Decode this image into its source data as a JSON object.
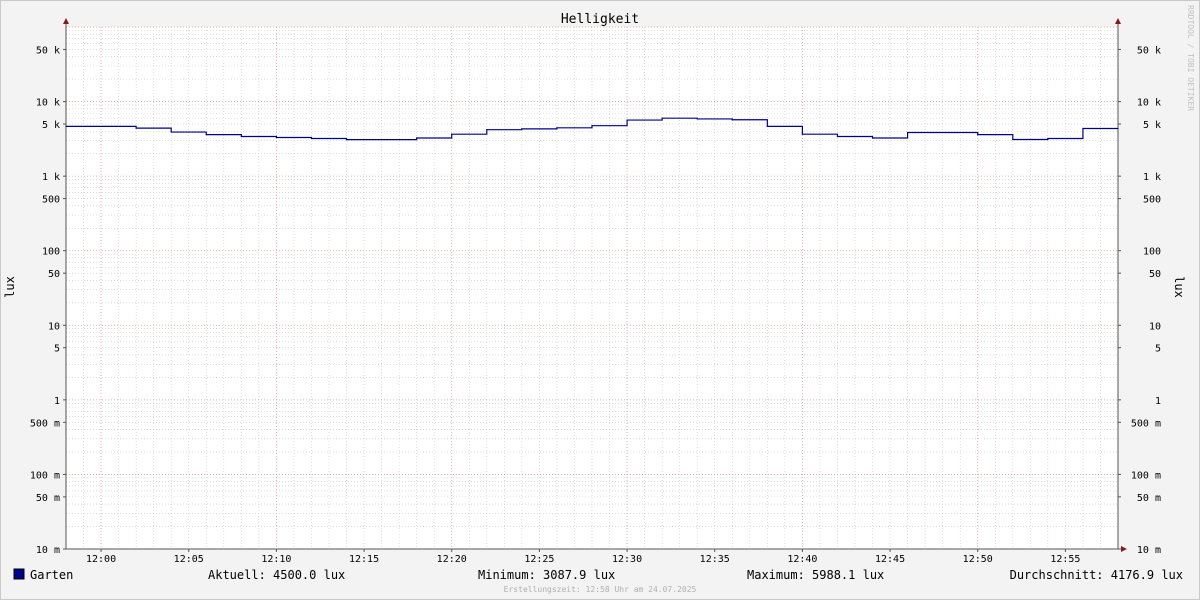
{
  "chart_data": {
    "type": "line",
    "title": "Helligkeit",
    "ylabel_left": "lux",
    "ylabel_right": "lux",
    "yscale": "log",
    "ylim": [
      0.01,
      100000
    ],
    "y_ticks": [
      {
        "value": 50000,
        "label": "50 k"
      },
      {
        "value": 10000,
        "label": "10 k"
      },
      {
        "value": 5000,
        "label": "5 k"
      },
      {
        "value": 1000,
        "label": "1 k"
      },
      {
        "value": 500,
        "label": "500"
      },
      {
        "value": 100,
        "label": "100"
      },
      {
        "value": 50,
        "label": "50"
      },
      {
        "value": 10,
        "label": "10"
      },
      {
        "value": 5,
        "label": "5"
      },
      {
        "value": 1,
        "label": "1"
      },
      {
        "value": 0.5,
        "label": "500 m"
      },
      {
        "value": 0.1,
        "label": "100 m"
      },
      {
        "value": 0.05,
        "label": "50 m"
      },
      {
        "value": 0.01,
        "label": "10 m"
      }
    ],
    "xlim": [
      "11:58",
      "12:58"
    ],
    "x_ticks": [
      "12:00",
      "12:05",
      "12:10",
      "12:15",
      "12:20",
      "12:25",
      "12:30",
      "12:35",
      "12:40",
      "12:45",
      "12:50",
      "12:55"
    ],
    "grid": true,
    "series": [
      {
        "name": "Garten",
        "color": "#00008b",
        "step": true,
        "points": [
          {
            "x": "11:58",
            "y": 4650
          },
          {
            "x": "12:02",
            "y": 4400
          },
          {
            "x": "12:04",
            "y": 3900
          },
          {
            "x": "12:06",
            "y": 3600
          },
          {
            "x": "12:08",
            "y": 3400
          },
          {
            "x": "12:10",
            "y": 3300
          },
          {
            "x": "12:12",
            "y": 3200
          },
          {
            "x": "12:14",
            "y": 3088
          },
          {
            "x": "12:18",
            "y": 3250
          },
          {
            "x": "12:20",
            "y": 3650
          },
          {
            "x": "12:22",
            "y": 4200
          },
          {
            "x": "12:24",
            "y": 4300
          },
          {
            "x": "12:26",
            "y": 4450
          },
          {
            "x": "12:28",
            "y": 4750
          },
          {
            "x": "12:30",
            "y": 5650
          },
          {
            "x": "12:32",
            "y": 5988
          },
          {
            "x": "12:34",
            "y": 5850
          },
          {
            "x": "12:36",
            "y": 5700
          },
          {
            "x": "12:38",
            "y": 4650
          },
          {
            "x": "12:40",
            "y": 3650
          },
          {
            "x": "12:42",
            "y": 3400
          },
          {
            "x": "12:44",
            "y": 3250
          },
          {
            "x": "12:46",
            "y": 3850
          },
          {
            "x": "12:50",
            "y": 3600
          },
          {
            "x": "12:52",
            "y": 3100
          },
          {
            "x": "12:54",
            "y": 3200
          },
          {
            "x": "12:56",
            "y": 4350
          },
          {
            "x": "12:58",
            "y": 4350
          }
        ]
      }
    ]
  },
  "legend": {
    "name": "Garten",
    "color": "#00008b",
    "current": "Aktuell: 4500.0 lux",
    "minimum": "Minimum: 3087.9 lux",
    "maximum": "Maximum: 5988.1 lux",
    "average": "Durchschnitt: 4176.9 lux"
  },
  "footer": "Erstellungszeit: 12:58 Uhr am 24.07.2025",
  "watermark": "RRDTOOL / TOBI OETIKER",
  "colors": {
    "canvas": "#ffffff",
    "background": "#f3f3f3",
    "minor_grid": "#c8c8c8",
    "major_grid": "#e8a0a0",
    "axis": "#555555",
    "arrow": "#8b1a1a"
  }
}
